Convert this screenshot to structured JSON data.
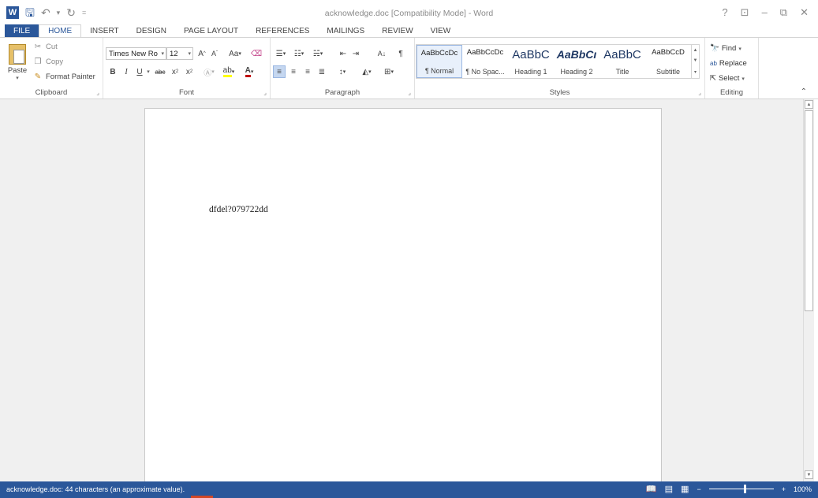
{
  "titlebar": {
    "title": "acknowledge.doc [Compatibility Mode] - Word",
    "logo": "W",
    "qat_icons": [
      "save-icon",
      "undo-icon",
      "redo-icon",
      "customize-qat-icon"
    ],
    "controls": {
      "help": "?",
      "ribbon_options": "⊡",
      "minimize": "–",
      "restore": "⧉",
      "close": "✕"
    }
  },
  "tabs": [
    "FILE",
    "HOME",
    "INSERT",
    "DESIGN",
    "PAGE LAYOUT",
    "REFERENCES",
    "MAILINGS",
    "REVIEW",
    "VIEW"
  ],
  "active_tab": "HOME",
  "ribbon": {
    "clipboard": {
      "label": "Clipboard",
      "paste": "Paste",
      "cut": "Cut",
      "copy": "Copy",
      "format_painter": "Format Painter"
    },
    "font": {
      "label": "Font",
      "font_name": "Times New Ro",
      "font_size": "12",
      "grow": "A",
      "shrink": "A",
      "change_case": "Aa",
      "bold": "B",
      "italic": "I",
      "underline": "U",
      "strikethrough": "abc",
      "subscript": "x",
      "superscript": "x"
    },
    "paragraph": {
      "label": "Paragraph",
      "pilcrow": "¶",
      "sort": "A↓"
    },
    "styles": {
      "label": "Styles",
      "items": [
        {
          "preview": "AaBbCcDc",
          "name": "¶ Normal"
        },
        {
          "preview": "AaBbCcDc",
          "name": "¶ No Spac..."
        },
        {
          "preview": "AaBbC",
          "name": "Heading 1"
        },
        {
          "preview": "AaBbCı",
          "name": "Heading 2"
        },
        {
          "preview": "AaBbC",
          "name": "Title"
        },
        {
          "preview": "AaBbCcD",
          "name": "Subtitle"
        }
      ]
    },
    "editing": {
      "label": "Editing",
      "find": "Find",
      "replace": "Replace",
      "select": "Select"
    }
  },
  "document": {
    "text": "dfdel?079722dd"
  },
  "status": {
    "text": "acknowledge.doc: 44 characters (an approximate value).",
    "zoom": "100%",
    "zoom_minus": "−",
    "zoom_plus": "+"
  },
  "colors": {
    "accent": "#2b579a",
    "font_color": "#c00000",
    "highlight": "#ffff00"
  }
}
